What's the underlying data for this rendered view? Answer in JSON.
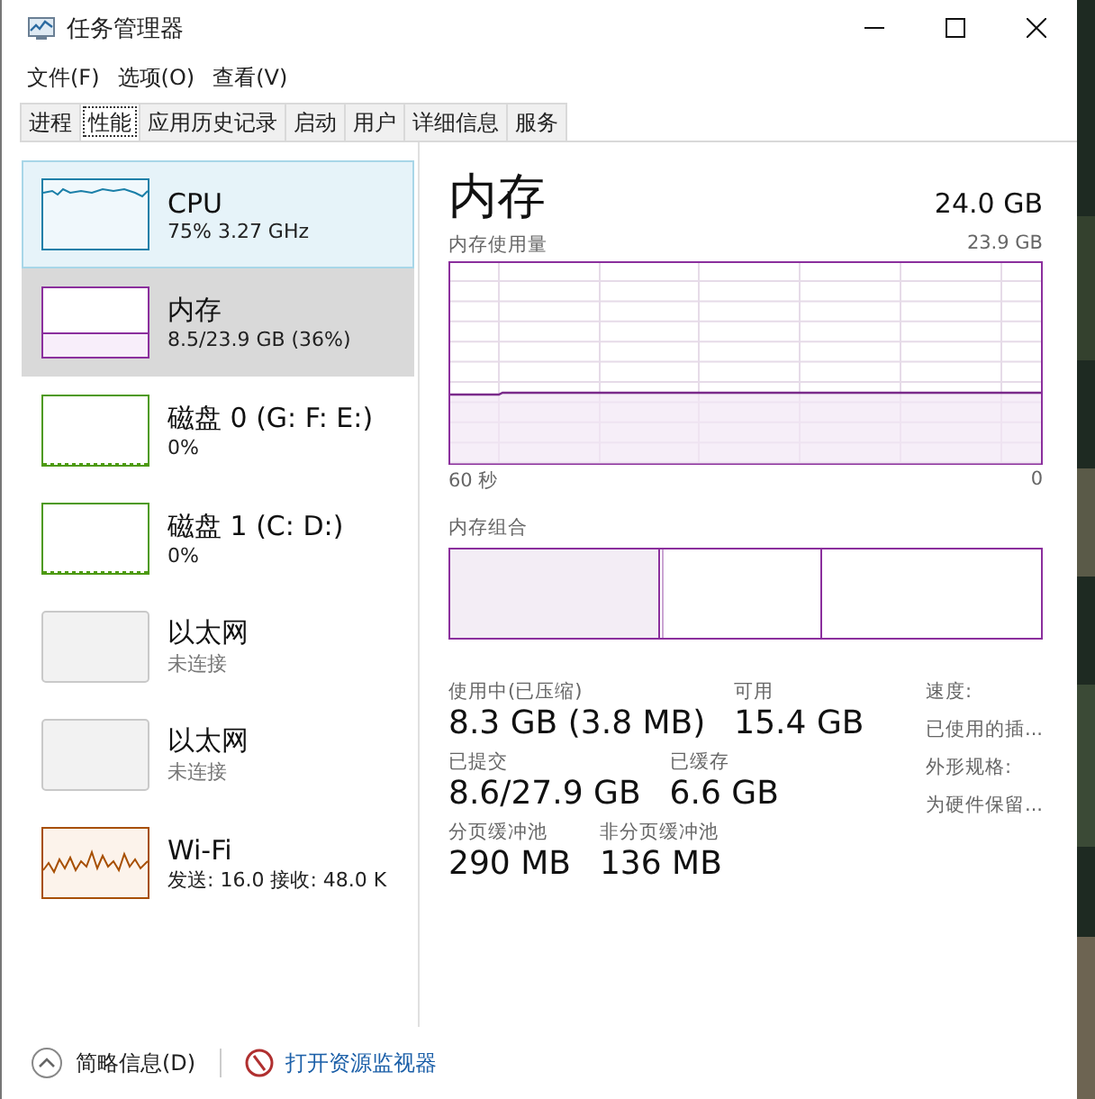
{
  "window": {
    "title": "任务管理器"
  },
  "menu": [
    "文件(F)",
    "选项(O)",
    "查看(V)"
  ],
  "tabs": [
    {
      "label": "进程",
      "selected": false
    },
    {
      "label": "性能",
      "selected": true
    },
    {
      "label": "应用历史记录",
      "selected": false
    },
    {
      "label": "启动",
      "selected": false
    },
    {
      "label": "用户",
      "selected": false
    },
    {
      "label": "详细信息",
      "selected": false
    },
    {
      "label": "服务",
      "selected": false
    }
  ],
  "sidebar": {
    "items": [
      {
        "kind": "cpu",
        "name": "CPU",
        "detail": "75% 3.27 GHz",
        "selected": false,
        "hovered": true
      },
      {
        "kind": "memory",
        "name": "内存",
        "detail": "8.5/23.9 GB (36%)",
        "selected": true,
        "hovered": false
      },
      {
        "kind": "disk",
        "name": "磁盘 0 (G: F: E:)",
        "detail": "0%",
        "selected": false,
        "hovered": false
      },
      {
        "kind": "disk",
        "name": "磁盘 1 (C: D:)",
        "detail": "0%",
        "selected": false,
        "hovered": false
      },
      {
        "kind": "ethernet",
        "name": "以太网",
        "detail": "未连接",
        "selected": false,
        "hovered": false
      },
      {
        "kind": "ethernet",
        "name": "以太网",
        "detail": "未连接",
        "selected": false,
        "hovered": false
      },
      {
        "kind": "wifi",
        "name": "Wi-Fi",
        "detail": "发送: 16.0 接收: 48.0 K",
        "selected": false,
        "hovered": false
      }
    ]
  },
  "detail": {
    "title": "内存",
    "total": "24.0 GB",
    "usage_graph": {
      "label": "内存使用量",
      "max": "23.9 GB",
      "time_start": "60 秒",
      "time_end": "0"
    },
    "composition_label": "内存组合",
    "stats": [
      {
        "label": "使用中(已压缩)",
        "value": "8.3 GB (3.8 MB)"
      },
      {
        "label": "可用",
        "value": "15.4 GB"
      },
      {
        "label": "已提交",
        "value": "8.6/27.9 GB"
      },
      {
        "label": "已缓存",
        "value": "6.6 GB"
      },
      {
        "label": "分页缓冲池",
        "value": "290 MB"
      },
      {
        "label": "非分页缓冲池",
        "value": "136 MB"
      }
    ],
    "properties": [
      "速度:",
      "已使用的插...",
      "外形规格:",
      "为硬件保留..."
    ]
  },
  "footer": {
    "summary": "简略信息(D)",
    "monitor_link": "打开资源监视器"
  }
}
